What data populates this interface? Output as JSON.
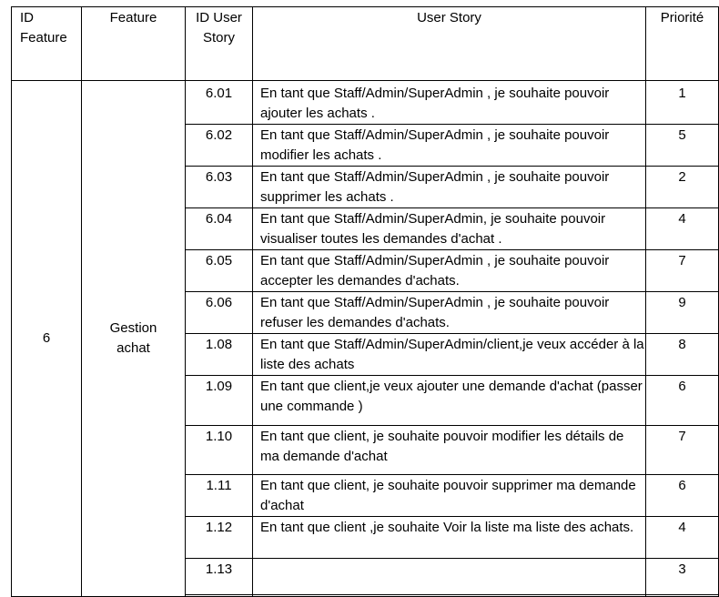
{
  "table": {
    "headers": {
      "id_feature": "ID Feature",
      "feature": "Feature",
      "id_user_story": "ID User Story",
      "user_story": "User Story",
      "priority": "Priorité"
    },
    "feature_id": "6",
    "feature_name": "Gestion achat",
    "rows": [
      {
        "id": "6.01",
        "story": "En tant que Staff/Admin/SuperAdmin  , je souhaite pouvoir  ajouter les achats .",
        "priority": "1"
      },
      {
        "id": "6.02",
        "story": "En tant que Staff/Admin/SuperAdmin  , je souhaite pouvoir  modifier les achats .",
        "priority": "5"
      },
      {
        "id": "6.03",
        "story": "En tant que Staff/Admin/SuperAdmin  , je souhaite pouvoir  supprimer  les achats .",
        "priority": "2"
      },
      {
        "id": "6.04",
        "story": "En tant que Staff/Admin/SuperAdmin,  je souhaite pouvoir visualiser  toutes les demandes d'achat .",
        "priority": "4"
      },
      {
        "id": "6.05",
        "story": "En tant que Staff/Admin/SuperAdmin  , je souhaite pouvoir accepter les demandes  d'achats.",
        "priority": "7"
      },
      {
        "id": "6.06",
        "story": "En tant que Staff/Admin/SuperAdmin  , je souhaite pouvoir refuser  les demandes  d'achats.",
        "priority": "9"
      },
      {
        "id": "1.08",
        "story": "En tant que Staff/Admin/SuperAdmin/client,je  veux accéder à la liste des achats",
        "priority": "8"
      },
      {
        "id": "1.09",
        "story": "En tant que client,je  veux ajouter une demande d'achat (passer une commande )",
        "priority": "6"
      },
      {
        "id": "1.10",
        "story": "En tant que client,  je souhaite pouvoir modifier les détails de ma demande d'achat",
        "priority": "7"
      },
      {
        "id": "1.11",
        "story": "En tant que client,  je souhaite pouvoir supprimer  ma demande  d'achat",
        "priority": "6"
      },
      {
        "id": "1.12",
        "story": "En tant que client  ,je souhaite Voir la liste ma liste des achats.",
        "priority": "4"
      },
      {
        "id": "1.13",
        "story": "",
        "priority": "3"
      }
    ]
  }
}
